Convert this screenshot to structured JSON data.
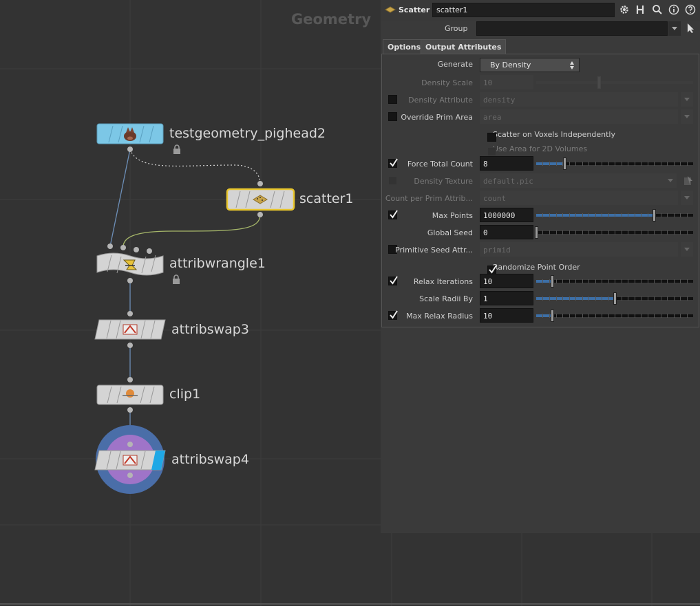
{
  "network": {
    "context": "Geometry",
    "nodes": [
      {
        "name": "testgeometry_pighead2",
        "locked": true
      },
      {
        "name": "scatter1",
        "locked": false
      },
      {
        "name": "attribwrangle1",
        "locked": true
      },
      {
        "name": "attribswap3",
        "locked": false
      },
      {
        "name": "clip1",
        "locked": false
      },
      {
        "name": "attribswap4",
        "locked": false
      }
    ]
  },
  "params": {
    "type": "Scatter",
    "node_name": "scatter1",
    "group_label": "Group",
    "group_value": "",
    "tabs": [
      "Options",
      "Output Attributes"
    ],
    "active_tab": "Output Attributes",
    "generate": {
      "label": "Generate",
      "value": "By Density"
    },
    "density_scale": {
      "label": "Density Scale",
      "value": "10",
      "enabled": false
    },
    "density_attribute": {
      "label": "Density Attribute",
      "value": "density",
      "checked": false
    },
    "override_prim_area": {
      "label": "Override Prim Area",
      "value": "area",
      "checked": false
    },
    "scatter_voxels": {
      "label": "Scatter on Voxels Independently",
      "checked": false
    },
    "use_area_2d": {
      "label": "Use Area for 2D Volumes",
      "checked": false,
      "enabled": false
    },
    "force_total_count": {
      "label": "Force Total Count",
      "value": "8",
      "checked": true,
      "slider": 0.18
    },
    "density_texture": {
      "label": "Density Texture",
      "value": "default.pic",
      "enabled": false
    },
    "count_per_prim": {
      "label": "Count per Prim Attrib...",
      "value": "count",
      "enabled": false
    },
    "max_points": {
      "label": "Max Points",
      "value": "1000000",
      "checked": true,
      "slider": 0.75
    },
    "global_seed": {
      "label": "Global Seed",
      "value": "0",
      "slider": 0.0
    },
    "prim_seed_attr": {
      "label": "Primitive Seed Attr...",
      "value": "primid",
      "checked": false
    },
    "randomize_order": {
      "label": "Randomize Point Order",
      "checked": true
    },
    "relax_iterations": {
      "label": "Relax Iterations",
      "value": "10",
      "checked": true,
      "slider": 0.1
    },
    "scale_radii": {
      "label": "Scale Radii By",
      "value": "1",
      "slider": 0.5
    },
    "max_relax_radius": {
      "label": "Max Relax Radius",
      "value": "10",
      "checked": true,
      "slider": 0.1
    }
  },
  "colors": {
    "background": "#333333",
    "grid": "#3b3b3b",
    "pighead_node": "#7cc7e6",
    "node_body": "#d4d4d4",
    "selected_outline": "#e8c62e",
    "display_ring_outer": "#4a6ea8",
    "display_ring_inner": "#9f74c8",
    "slider_fill": "#3d6fa6"
  }
}
